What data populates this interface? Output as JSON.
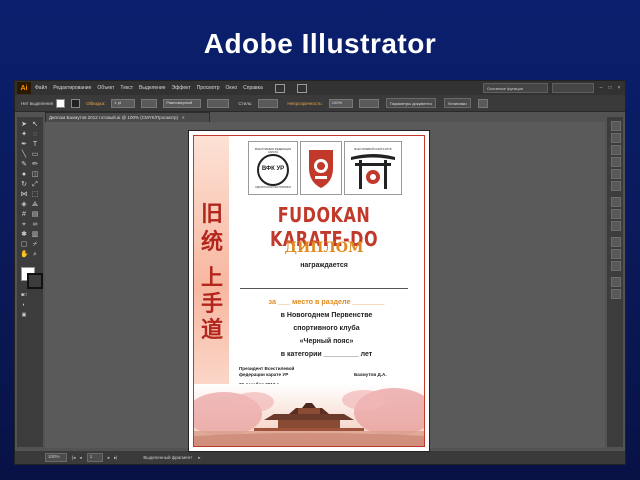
{
  "slide": {
    "title": "Adobe Illustrator"
  },
  "app": {
    "logo": "Ai",
    "menu": [
      "Файл",
      "Редактирование",
      "Объект",
      "Текст",
      "Выделение",
      "Эффект",
      "Просмотр",
      "Окно",
      "Справка"
    ],
    "workspace_label": "Основные функции"
  },
  "control_bar": {
    "selection_label": "Нет выделения",
    "stroke_label": "Обводка:",
    "stroke_value": "1 pt",
    "brush_value": "Равномерный",
    "style_label": "Стиль:",
    "opacity_label": "Непрозрачность:",
    "opacity_value": "100%",
    "document_setup_button": "Параметры документа",
    "preferences_button": "Установки"
  },
  "document_tab": {
    "label": "Диплом Бахмутов 2012 готовый.ai @ 100% (CMYK/Просмотр)"
  },
  "status_bar": {
    "zoom": "100%",
    "page": "1",
    "tool_name": "Выделенный фрагмент"
  },
  "diploma": {
    "seal1_caption": "ВСЕСТИЛЕВАЯ ФЕДЕРАЦИЯ КАРАТЭ",
    "seal1_text": "ВФК УР",
    "seal1_bottom": "УДМУРТСКОЙ РЕСПУБЛИКИ",
    "seal3_caption": "ВСЕСТИЛЕВОЙ КАРАТЭ КЛУБ",
    "calligraphy": [
      "旧",
      "统",
      "上",
      "手",
      "道"
    ],
    "title": "FUDOKAN KARATE-DO",
    "subtitle": "ДИПЛОМ",
    "awarded": "награждается",
    "place_line": "за ___ место в разделе ________",
    "line2": "в Новогоднем Первенстве",
    "line3": "спортивного клуба",
    "line4": "«Черный пояс»",
    "line5": "в категории _________ лет",
    "signer_title1": "Президент Всестилевой",
    "signer_title2": "федерации карате УР",
    "signer_name": "Бахмутов Д.А.",
    "date": "29 декабря 2012 г."
  },
  "colors": {
    "slide_bg": "#0b1f6e",
    "accent_red": "#c0392b",
    "accent_orange": "#e08a1e",
    "ui_dark": "#323232"
  }
}
